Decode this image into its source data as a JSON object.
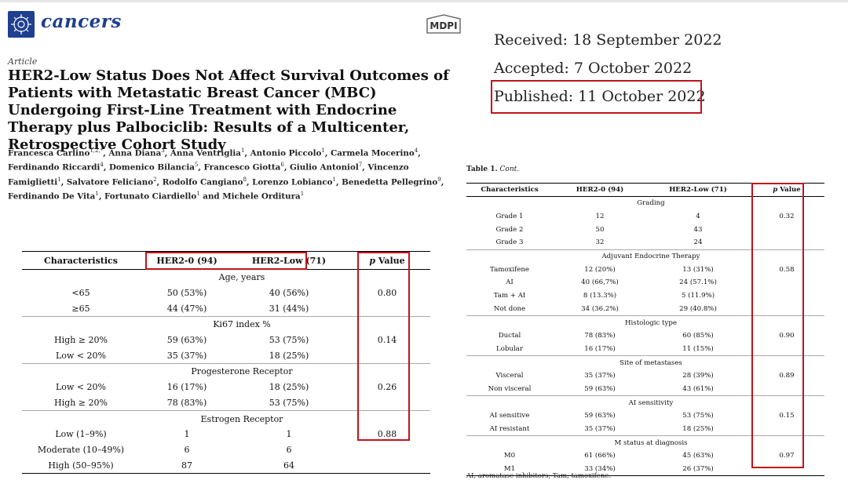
{
  "header": {
    "journal": "cancers",
    "publisher": "MDPI",
    "article_type": "Article",
    "title": "HER2-Low Status Does Not Affect Survival Outcomes of Patients with Metastatic Breast Cancer (MBC) Undergoing First-Line Treatment with Endocrine Therapy plus Palbociclib: Results of a Multicenter, Retrospective Cohort Study",
    "authors": [
      {
        "name": "Francesca Carlino",
        "sup": "1,2,*"
      },
      {
        "name": "Anna Diana",
        "sup": "3"
      },
      {
        "name": "Anna Ventriglia",
        "sup": "1"
      },
      {
        "name": "Antonio Piccolo",
        "sup": "1"
      },
      {
        "name": "Carmela Mocerino",
        "sup": "4"
      },
      {
        "name": "Ferdinando Riccardi",
        "sup": "4"
      },
      {
        "name": "Domenico Bilancia",
        "sup": "5"
      },
      {
        "name": "Francesco Giotta",
        "sup": "6"
      },
      {
        "name": "Giulio Antoniol",
        "sup": "7"
      },
      {
        "name": "Vincenzo Famiglietti",
        "sup": "1"
      },
      {
        "name": "Salvatore Feliciano",
        "sup": "2"
      },
      {
        "name": "Rodolfo Cangiano",
        "sup": "8"
      },
      {
        "name": "Lorenzo Lobianco",
        "sup": "1"
      },
      {
        "name": "Benedetta Pellegrino",
        "sup": "9"
      },
      {
        "name": "Ferdinando De Vita",
        "sup": "1"
      },
      {
        "name": "Fortunato Ciardiello",
        "sup": "1"
      },
      {
        "name": "Michele Orditura",
        "sup": "1"
      }
    ]
  },
  "dates": {
    "received": "Received: 18 September 2022",
    "accepted": "Accepted: 7 October 2022",
    "published": "Published: 11 October 2022"
  },
  "left_table": {
    "headers": {
      "characteristics": "Characteristics",
      "her2_0": "HER2-0 (94)",
      "her2_low": "HER2-Low (71)",
      "p_italic": "p",
      "p_rest": " Value"
    },
    "rows": [
      {
        "type": "group",
        "label": "Age, years"
      },
      {
        "label": "<65",
        "a": "50 (53%)",
        "b": "40 (56%)",
        "p": "0.80"
      },
      {
        "label": "≥65",
        "a": "44 (47%)",
        "b": "31 (44%)",
        "p": ""
      },
      {
        "type": "group",
        "label": "Ki67 index %"
      },
      {
        "label": "High ≥ 20%",
        "a": "59 (63%)",
        "b": "53 (75%)",
        "p": "0.14"
      },
      {
        "label": "Low < 20%",
        "a": "35 (37%)",
        "b": "18 (25%)",
        "p": ""
      },
      {
        "type": "group",
        "label": "Progesterone Receptor"
      },
      {
        "label": "Low < 20%",
        "a": "16 (17%)",
        "b": "18 (25%)",
        "p": "0.26"
      },
      {
        "label": "High ≥ 20%",
        "a": "78 (83%)",
        "b": "53 (75%)",
        "p": ""
      },
      {
        "type": "group",
        "label": "Estrogen Receptor"
      },
      {
        "label": "Low (1–9%)",
        "a": "1",
        "b": "1",
        "p": "0.88"
      },
      {
        "label": "Moderate (10–49%)",
        "a": "6",
        "b": "6",
        "p": ""
      },
      {
        "label": "High (50–95%)",
        "a": "87",
        "b": "64",
        "p": ""
      }
    ]
  },
  "right_table": {
    "caption_bold": "Table 1.",
    "caption_rest": "Cont.",
    "headers": {
      "characteristics": "Characteristics",
      "her2_0": "HER2-0 (94)",
      "her2_low": "HER2-Low (71)",
      "p_italic": "p",
      "p_rest": " Value"
    },
    "rows": [
      {
        "type": "group",
        "label": "Grading"
      },
      {
        "label": "Grade 1",
        "a": "12",
        "b": "4",
        "p": "0.32"
      },
      {
        "label": "Grade 2",
        "a": "50",
        "b": "43",
        "p": ""
      },
      {
        "label": "Grade 3",
        "a": "32",
        "b": "24",
        "p": ""
      },
      {
        "type": "group",
        "label": "Adjuvant Endocrine Therapy"
      },
      {
        "label": "Tamoxifene",
        "a": "12 (20%)",
        "b": "13 (31%)",
        "p": "0.58"
      },
      {
        "label": "AI",
        "a": "40 (66,7%)",
        "b": "24 (57.1%)",
        "p": ""
      },
      {
        "label": "Tam + AI",
        "a": "8 (13.3%)",
        "b": "5 (11.9%)",
        "p": ""
      },
      {
        "label": "Not done",
        "a": "34 (36.2%)",
        "b": "29 (40.8%)",
        "p": ""
      },
      {
        "type": "group",
        "label": "Histologic type"
      },
      {
        "label": "Ductal",
        "a": "78 (83%)",
        "b": "60 (85%)",
        "p": "0.90"
      },
      {
        "label": "Lobular",
        "a": "16 (17%)",
        "b": "11 (15%)",
        "p": ""
      },
      {
        "type": "group",
        "label": "Site of metastases"
      },
      {
        "label": "Visceral",
        "a": "35 (37%)",
        "b": "28 (39%)",
        "p": "0.89"
      },
      {
        "label": "Non visceral",
        "a": "59 (63%)",
        "b": "43 (61%)",
        "p": ""
      },
      {
        "type": "group",
        "label": "AI sensitivity"
      },
      {
        "label": "AI sensitive",
        "a": "59 (63%)",
        "b": "53 (75%)",
        "p": "0.15"
      },
      {
        "label": "AI resistant",
        "a": "35 (37%)",
        "b": "18 (25%)",
        "p": ""
      },
      {
        "type": "group",
        "label": "M status at diagnosis"
      },
      {
        "label": "M0",
        "a": "61 (66%)",
        "b": "45 (63%)",
        "p": "0.97"
      },
      {
        "label": "M1",
        "a": "33 (34%)",
        "b": "26 (37%)",
        "p": ""
      }
    ],
    "footnote": "AI, aromatase inhibitors; Tam, tamoxifene."
  },
  "colors": {
    "brand": "#1f3f8f",
    "highlight": "#c0141c"
  }
}
